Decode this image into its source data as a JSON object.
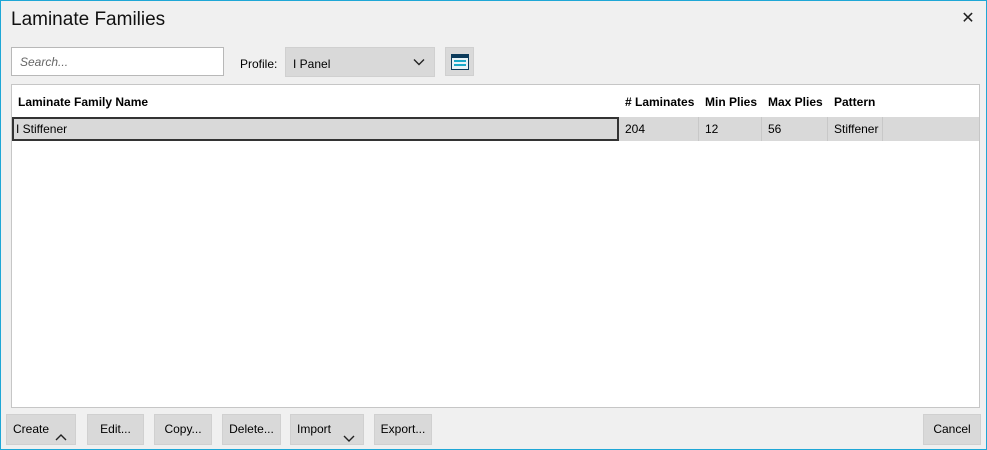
{
  "window": {
    "title": "Laminate Families",
    "accent": "#1ea7d6"
  },
  "toolbar": {
    "search_placeholder": "Search...",
    "profile_label": "Profile:",
    "profile_value": "I Panel"
  },
  "table": {
    "columns": [
      "Laminate Family Name",
      "# Laminates",
      "Min Plies",
      "Max Plies",
      "Pattern"
    ],
    "rows": [
      {
        "name": "I Stiffener",
        "laminates": "204",
        "min_plies": "12",
        "max_plies": "56",
        "pattern": "Stiffener"
      }
    ]
  },
  "buttons": {
    "create": "Create",
    "edit": "Edit...",
    "copy": "Copy...",
    "delete": "Delete...",
    "import": "Import",
    "export": "Export...",
    "cancel": "Cancel"
  }
}
